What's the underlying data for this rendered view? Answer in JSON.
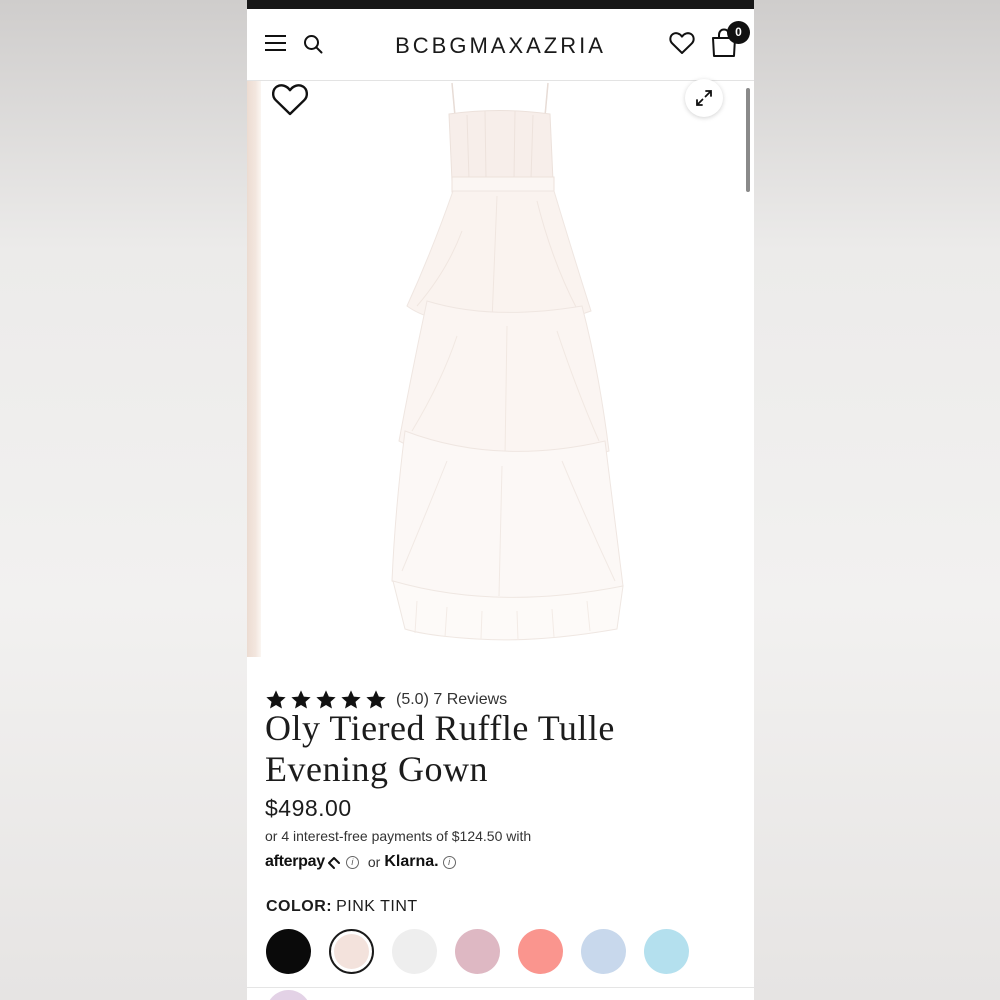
{
  "header": {
    "brand": "BCBGMAXAZRIA",
    "cart_count": "0"
  },
  "product": {
    "rating_value": 5,
    "rating_text": "(5.0) 7 Reviews",
    "title": "Oly Tiered Ruffle Tulle Evening Gown",
    "price": "$498.00",
    "installments": "or 4 interest-free payments of $124.50 with",
    "afterpay_label": "afterpay",
    "or_text": "or",
    "klarna_label": "Klarna."
  },
  "color": {
    "label": "COLOR:",
    "selected": "PINK TINT",
    "swatches": [
      {
        "name": "black",
        "hex": "#0a0a0a"
      },
      {
        "name": "pink-tint",
        "hex": "#f3e2dc",
        "selected": true
      },
      {
        "name": "light-gray",
        "hex": "#eeeeee"
      },
      {
        "name": "mauve",
        "hex": "#deb8c3"
      },
      {
        "name": "coral",
        "hex": "#fa958e"
      },
      {
        "name": "light-blue",
        "hex": "#c8d8ec"
      },
      {
        "name": "sky-blue",
        "hex": "#b4e0ee"
      }
    ]
  },
  "icons": {
    "menu": "menu-icon",
    "search": "search-icon",
    "wishlist": "heart-icon",
    "bag": "shopping-bag-icon",
    "zoom": "expand-icon",
    "star": "star-icon",
    "info": "info-icon"
  }
}
